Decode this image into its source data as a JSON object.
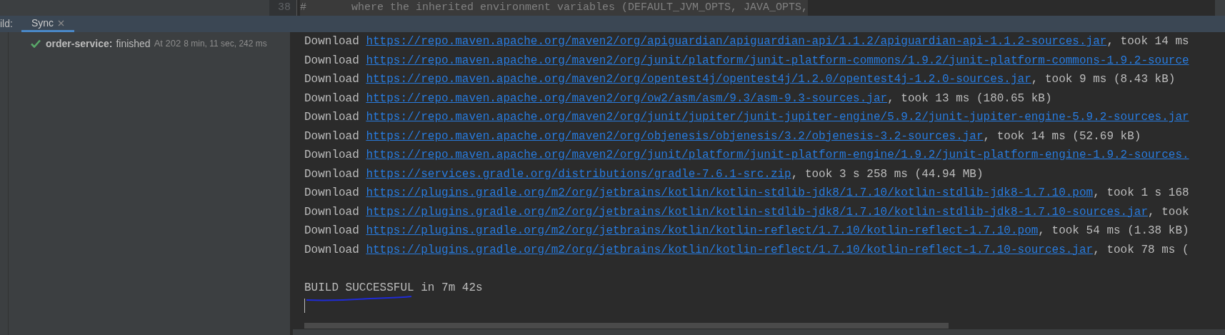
{
  "editor": {
    "line_number": "38",
    "text": "#       where the inherited environment variables (DEFAULT_JVM_OPTS, JAVA_OPTS,"
  },
  "build_panel": {
    "label": "ild:",
    "tabs": [
      {
        "label": "Sync",
        "selected": true,
        "closable": true
      }
    ]
  },
  "tree": {
    "items": [
      {
        "kind": "success",
        "name": "order-service:",
        "status": "finished",
        "started": "At 202",
        "duration": "8 min, 11 sec, 242 ms"
      }
    ]
  },
  "console": {
    "lines": [
      {
        "kind": "download",
        "label": "Download",
        "url": "https://repo.maven.apache.org/maven2/org/apiguardian/apiguardian-api/1.1.2/apiguardian-api-1.1.2-sources.jar",
        "suffix": ", took 14 ms"
      },
      {
        "kind": "download",
        "label": "Download",
        "url": "https://repo.maven.apache.org/maven2/org/junit/platform/junit-platform-commons/1.9.2/junit-platform-commons-1.9.2-source"
      },
      {
        "kind": "download",
        "label": "Download",
        "url": "https://repo.maven.apache.org/maven2/org/opentest4j/opentest4j/1.2.0/opentest4j-1.2.0-sources.jar",
        "suffix": ", took 9 ms (8.43 kB)"
      },
      {
        "kind": "download",
        "label": "Download",
        "url": "https://repo.maven.apache.org/maven2/org/ow2/asm/asm/9.3/asm-9.3-sources.jar",
        "suffix": ", took 13 ms (180.65 kB)"
      },
      {
        "kind": "download",
        "label": "Download",
        "url": "https://repo.maven.apache.org/maven2/org/junit/jupiter/junit-jupiter-engine/5.9.2/junit-jupiter-engine-5.9.2-sources.jar"
      },
      {
        "kind": "download",
        "label": "Download",
        "url": "https://repo.maven.apache.org/maven2/org/objenesis/objenesis/3.2/objenesis-3.2-sources.jar",
        "suffix": ", took 14 ms (52.69 kB)"
      },
      {
        "kind": "download",
        "label": "Download",
        "url": "https://repo.maven.apache.org/maven2/org/junit/platform/junit-platform-engine/1.9.2/junit-platform-engine-1.9.2-sources."
      },
      {
        "kind": "download",
        "label": "Download",
        "url": "https://services.gradle.org/distributions/gradle-7.6.1-src.zip",
        "suffix": ", took 3 s 258 ms (44.94 MB)"
      },
      {
        "kind": "download",
        "label": "Download",
        "url": "https://plugins.gradle.org/m2/org/jetbrains/kotlin/kotlin-stdlib-jdk8/1.7.10/kotlin-stdlib-jdk8-1.7.10.pom",
        "suffix": ", took 1 s 168"
      },
      {
        "kind": "download",
        "label": "Download",
        "url": "https://plugins.gradle.org/m2/org/jetbrains/kotlin/kotlin-stdlib-jdk8/1.7.10/kotlin-stdlib-jdk8-1.7.10-sources.jar",
        "suffix": ", took"
      },
      {
        "kind": "download",
        "label": "Download",
        "url": "https://plugins.gradle.org/m2/org/jetbrains/kotlin/kotlin-reflect/1.7.10/kotlin-reflect-1.7.10.pom",
        "suffix": ", took 54 ms (1.38 kB)"
      },
      {
        "kind": "download",
        "label": "Download",
        "url": "https://plugins.gradle.org/m2/org/jetbrains/kotlin/kotlin-reflect/1.7.10/kotlin-reflect-1.7.10-sources.jar",
        "suffix": ", took 78 ms ("
      },
      {
        "kind": "blank"
      },
      {
        "kind": "result",
        "text": "BUILD SUCCESSFUL in 7m 42s",
        "underlined": true
      }
    ]
  }
}
